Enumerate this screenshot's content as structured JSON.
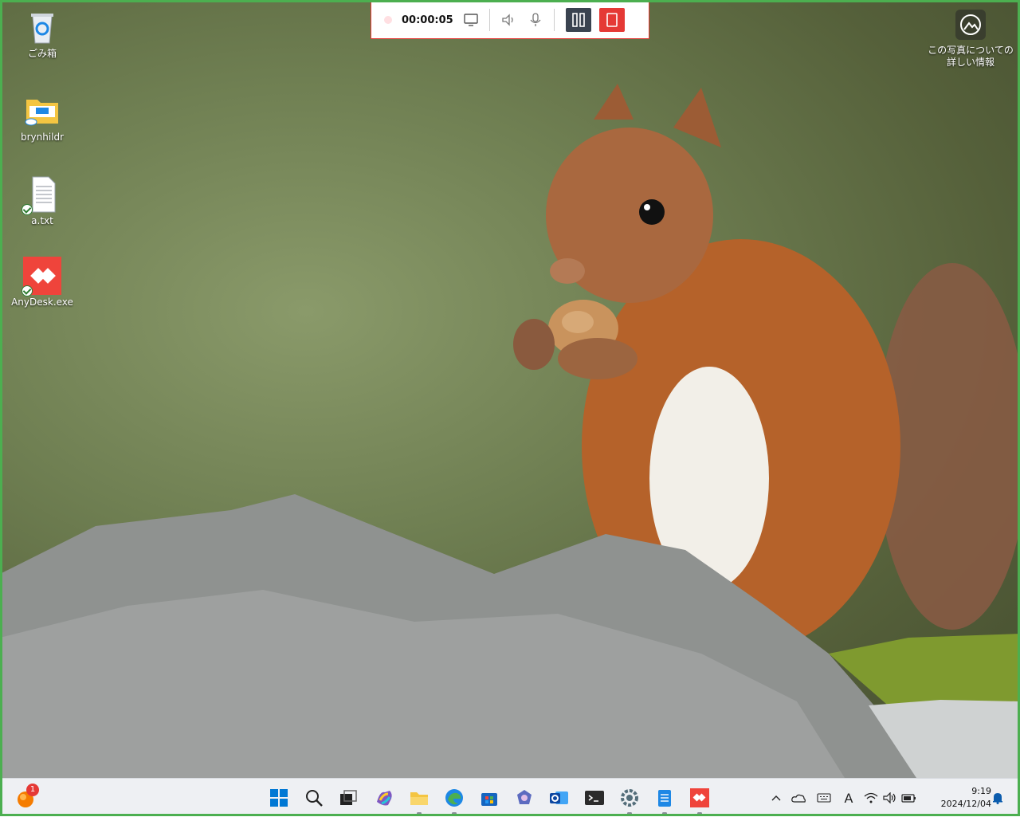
{
  "desktop": {
    "icons": [
      {
        "label": "ごみ箱",
        "icon": "recycle-bin-icon"
      },
      {
        "label": "brynhildr",
        "icon": "folder-icon"
      },
      {
        "label": "a.txt",
        "icon": "text-file-icon"
      },
      {
        "label": "AnyDesk.exe",
        "icon": "anydesk-icon"
      }
    ],
    "photo_info": {
      "label": "この写真についての詳しい情報",
      "icon": "photo-info-icon"
    }
  },
  "recorder": {
    "time": "00:00:05",
    "icons": [
      "record-dot-icon",
      "display-icon",
      "speaker-icon",
      "microphone-icon",
      "pause-icon",
      "stop-icon"
    ],
    "colors": {
      "border": "#e53935",
      "pause_bg": "#3a4350",
      "stop_bg": "#e53935"
    }
  },
  "taskbar": {
    "notification_badge": "1",
    "apps": [
      "start-icon",
      "search-icon",
      "task-view-icon",
      "copilot-icon",
      "file-explorer-icon",
      "edge-icon",
      "store-icon",
      "photos-icon",
      "outlook-icon",
      "terminal-icon",
      "settings-icon",
      "notepad-icon",
      "anydesk-icon"
    ],
    "tray": {
      "ime_label": "A",
      "icons": [
        "chevron-up-icon",
        "onedrive-icon",
        "keyboard-icon",
        "ime-icon",
        "wifi-icon",
        "volume-icon",
        "battery-icon",
        "bell-icon"
      ]
    },
    "clock": {
      "time": "9:19",
      "date": "2024/12/04"
    }
  },
  "colors": {
    "frame": "#4caf50",
    "accent": "#0078d4"
  }
}
